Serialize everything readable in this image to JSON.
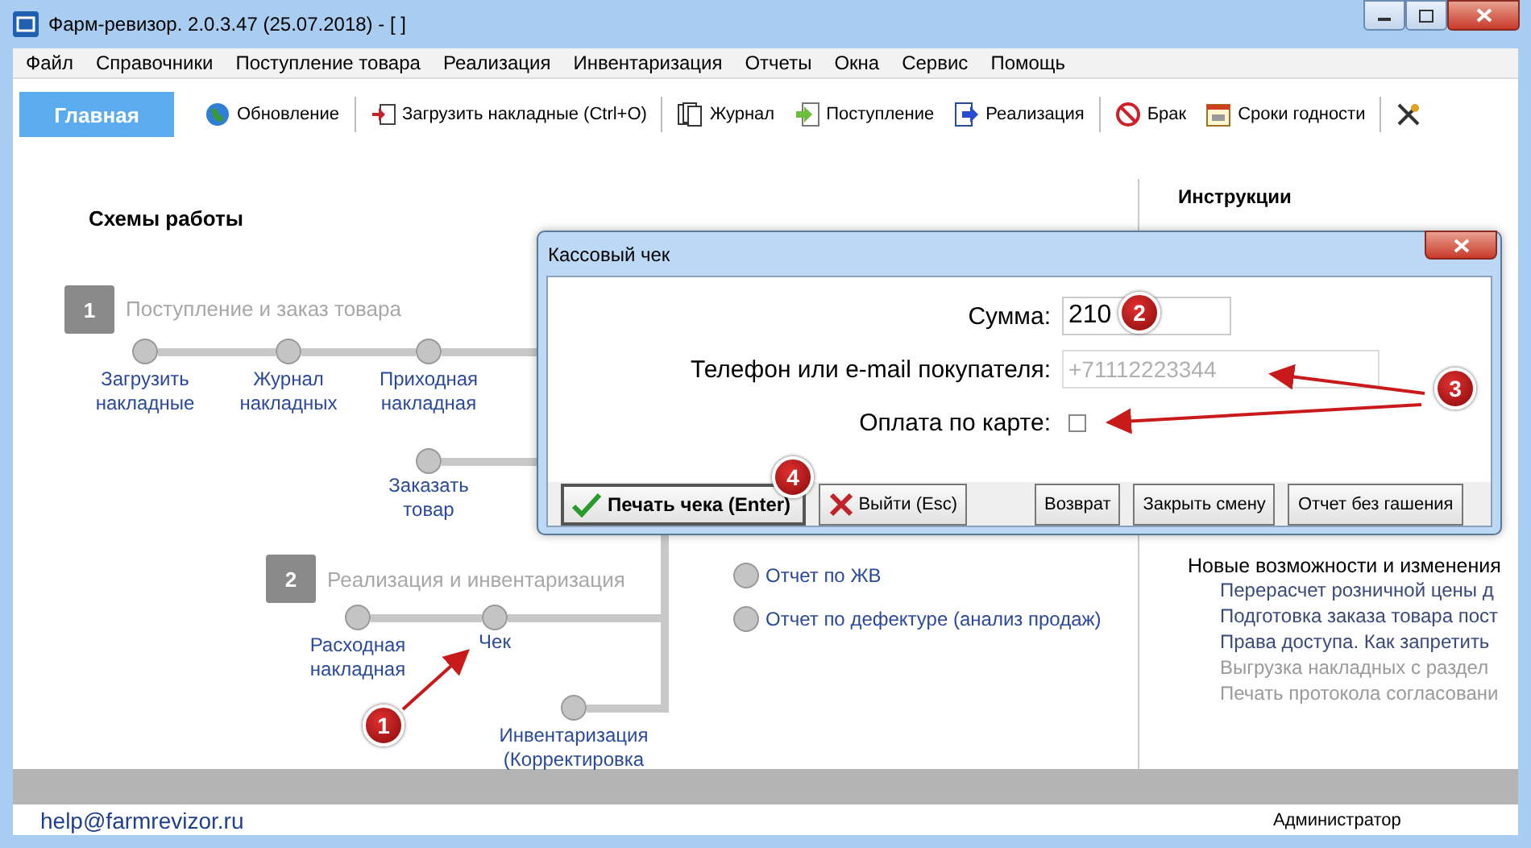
{
  "window": {
    "title": "Фарм-ревизор. 2.0.3.47 (25.07.2018) - [ ]"
  },
  "menu": [
    "Файл",
    "Справочники",
    "Поступление товара",
    "Реализация",
    "Инвентаризация",
    "Отчеты",
    "Окна",
    "Сервис",
    "Помощь"
  ],
  "toolbar": {
    "home_tab": {
      "label": "Главная",
      "selected": true
    },
    "buttons": [
      {
        "kind": "globe",
        "label": "Обновление"
      },
      {
        "kind": "load",
        "label": "Загрузить накладные (Ctrl+O)"
      },
      {
        "kind": "journal",
        "label": "Журнал"
      },
      {
        "kind": "income",
        "label": "Поступление"
      },
      {
        "kind": "sale",
        "label": "Реализация"
      },
      {
        "kind": "defect",
        "label": "Брак"
      },
      {
        "kind": "calendar",
        "label": "Сроки годности"
      },
      {
        "kind": "tools"
      }
    ]
  },
  "schemes": {
    "title": "Схемы работы",
    "flows": [
      {
        "number": "1",
        "title": "Поступление и заказ товара",
        "steps": [
          "Загрузить накладные",
          "Журнал накладных",
          "Приходная накладная",
          "Заказать товар"
        ]
      },
      {
        "number": "2",
        "title": "Реализация и инвентаризация",
        "steps": [
          "Расходная накладная",
          "Чек",
          "Инвентаризация (Корректировка"
        ]
      }
    ],
    "reports": [
      "Отчет по ЖВ",
      "Отчет по дефектуре (анализ продаж)"
    ]
  },
  "instructions": {
    "title": "Инструкции",
    "news_title": "Новые возможности и изменения",
    "items": [
      {
        "text": "Перерасчет розничной цены д",
        "dimmed": false
      },
      {
        "text": "Подготовка заказа товара пост",
        "dimmed": false
      },
      {
        "text": "Права доступа. Как запретить",
        "dimmed": false
      },
      {
        "text": "Выгрузка накладных с раздел",
        "dimmed": true
      },
      {
        "text": "Печать протокола согласовани",
        "dimmed": true
      }
    ]
  },
  "dialog": {
    "title": "Кассовый чек",
    "sum": {
      "label": "Сумма:",
      "value": "210"
    },
    "contact": {
      "label": "Телефон или e-mail покупателя:",
      "placeholder": "+71112223344"
    },
    "card_payment": {
      "label": "Оплата по карте:",
      "checked": false
    },
    "buttons": [
      {
        "kind": "print",
        "label": "Печать чека (Enter)"
      },
      {
        "kind": "exit",
        "label": "Выйти (Esc)"
      },
      {
        "kind": "plain",
        "label": "Возврат"
      },
      {
        "kind": "plain",
        "label": "Закрыть смену"
      },
      {
        "kind": "plain",
        "label": "Отчет без гашения"
      }
    ]
  },
  "callouts": [
    "1",
    "2",
    "3",
    "4"
  ],
  "status_bar": {
    "email": "help@farmrevizor.ru",
    "user": "Администратор"
  }
}
